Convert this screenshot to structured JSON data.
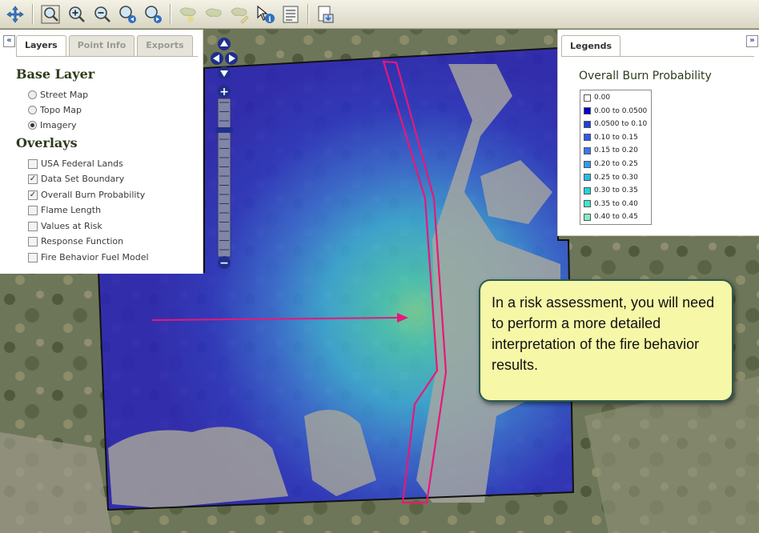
{
  "toolbar": {
    "buttons": [
      {
        "icon": "pan-icon"
      },
      {
        "icon": "zoom-full-extent-icon"
      },
      {
        "icon": "zoom-in-icon"
      },
      {
        "icon": "zoom-out-icon"
      },
      {
        "icon": "zoom-previous-icon"
      },
      {
        "icon": "zoom-next-icon"
      },
      {
        "icon": "select-polygon-icon"
      },
      {
        "icon": "select-area-icon"
      },
      {
        "icon": "edit-area-icon"
      },
      {
        "icon": "identify-icon"
      },
      {
        "icon": "report-icon"
      },
      {
        "icon": "export-icon"
      }
    ]
  },
  "left_panel": {
    "collapse_glyph": "«",
    "tabs": [
      {
        "label": "Layers",
        "active": true
      },
      {
        "label": "Point Info",
        "active": false
      },
      {
        "label": "Exports",
        "active": false
      }
    ],
    "base_layer_heading": "Base Layer",
    "base_layers": [
      {
        "label": "Street Map",
        "selected": false
      },
      {
        "label": "Topo Map",
        "selected": false
      },
      {
        "label": "Imagery",
        "selected": true
      }
    ],
    "overlays_heading": "Overlays",
    "overlays": [
      {
        "label": "USA Federal Lands",
        "checked": false
      },
      {
        "label": "Data Set Boundary",
        "checked": true
      },
      {
        "label": "Overall Burn Probability",
        "checked": true
      },
      {
        "label": "Flame Length",
        "checked": false
      },
      {
        "label": "Values at Risk",
        "checked": false
      },
      {
        "label": "Response Function",
        "checked": false
      },
      {
        "label": "Fire Behavior Fuel Model",
        "checked": false
      }
    ]
  },
  "zoom": {
    "plus": "+",
    "minus": "−",
    "level_marker": "—"
  },
  "legend_panel": {
    "expand_glyph": "»",
    "tab_label": "Legends",
    "title": "Overall Burn Probability",
    "items": [
      {
        "label": "0.00",
        "color": "#ffffff"
      },
      {
        "label": "0.00 to 0.0500",
        "color": "#0000c8"
      },
      {
        "label": "0.0500 to 0.10",
        "color": "#1f3fe0"
      },
      {
        "label": "0.10 to 0.15",
        "color": "#2b5cf0"
      },
      {
        "label": "0.15 to 0.20",
        "color": "#3a78f2"
      },
      {
        "label": "0.20 to 0.25",
        "color": "#2f9cf0"
      },
      {
        "label": "0.25 to 0.30",
        "color": "#25bde8"
      },
      {
        "label": "0.30 to 0.35",
        "color": "#22d6dc"
      },
      {
        "label": "0.35 to 0.40",
        "color": "#3fe6d0"
      },
      {
        "label": "0.40 to 0.45",
        "color": "#7ff0c0"
      }
    ]
  },
  "callout": {
    "text": "In a risk assessment, you will need to perform a more detailed interpretation of the fire behavior results."
  },
  "colors": {
    "annotation": "#e8177a",
    "callout_fill": "#f6f7a7",
    "callout_border": "#2c5b50"
  }
}
